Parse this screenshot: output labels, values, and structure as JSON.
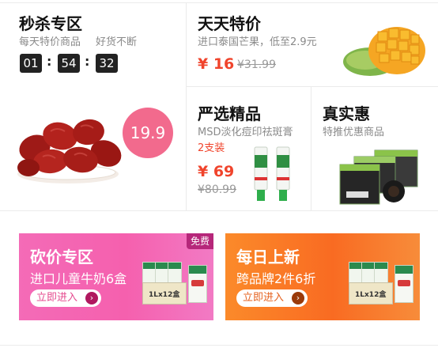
{
  "flash_sale": {
    "title": "秒杀专区",
    "subtitle_1": "每天特价商品",
    "subtitle_2": "好货不断",
    "countdown": [
      "01",
      "54",
      "32"
    ],
    "separator": ":",
    "price_badge": "19.9",
    "image_icon": "red-dates-icon"
  },
  "daily_special": {
    "title": "天天特价",
    "subtitle": "进口泰国芒果，低至2.9元",
    "price": "¥ 16",
    "old_price": "¥31.99",
    "image_icon": "mango-icon"
  },
  "selected": {
    "title": "严选精品",
    "subtitle": "MSD淡化痘印祛斑膏",
    "note": "2支装",
    "price": "¥ 69",
    "old_price": "¥80.99",
    "image_icon": "ointment-tube-icon"
  },
  "real_deal": {
    "title": "真实惠",
    "subtitle": "特推优惠商品",
    "image_icon": "product-boxes-icon"
  },
  "banners": [
    {
      "title": "砍价专区",
      "subtitle": "进口儿童牛奶6盒",
      "button": "立即进入",
      "tag": "免费",
      "case_label": "1Lx12盒",
      "image_icon": "milk-carton-icon"
    },
    {
      "title": "每日上新",
      "subtitle": "跨品牌2件6折",
      "button": "立即进入",
      "case_label": "1Lx12盒",
      "image_icon": "milk-carton-icon"
    }
  ],
  "colors": {
    "price_red": "#f0442c",
    "badge_pink": "#f26a8d",
    "banner_pink": "#f560ae",
    "banner_orange": "#f96b22"
  }
}
